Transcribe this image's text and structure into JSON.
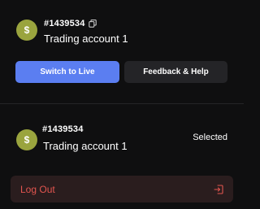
{
  "current_account": {
    "avatar_symbol": "$",
    "id": "#1439534",
    "name": "Trading account 1",
    "copy_icon": "copy-icon"
  },
  "actions": {
    "switch_label": "Switch to Live",
    "feedback_label": "Feedback & Help"
  },
  "accounts": [
    {
      "avatar_symbol": "$",
      "id": "#1439534",
      "name": "Trading account 1",
      "status": "Selected"
    }
  ],
  "logout": {
    "label": "Log Out",
    "icon": "logout-icon"
  },
  "colors": {
    "background": "#0f0f10",
    "avatar": "#9aa43e",
    "primary_button": "#5b7ef1",
    "secondary_button": "#242427",
    "logout_bg": "#2a1d1e",
    "logout_text": "#e2554f"
  }
}
